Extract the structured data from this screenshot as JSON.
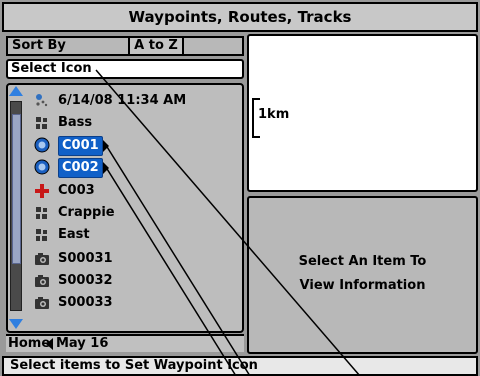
{
  "window": {
    "title": "Waypoints, Routes, Tracks"
  },
  "sort": {
    "label": "Sort By",
    "value": "A to Z"
  },
  "select_icon": {
    "label": "Select Icon"
  },
  "list": {
    "items": [
      {
        "label": "6/14/08 11:34 AM",
        "icon": "track-icon",
        "selected": false
      },
      {
        "label": "Bass",
        "icon": "fish-icon",
        "selected": false
      },
      {
        "label": "C001",
        "icon": "blue-circle-icon",
        "selected": true
      },
      {
        "label": "C002",
        "icon": "blue-circle-icon",
        "selected": true
      },
      {
        "label": "C003",
        "icon": "red-cross-icon",
        "selected": false
      },
      {
        "label": "Crappie",
        "icon": "fish-icon",
        "selected": false
      },
      {
        "label": "East",
        "icon": "fish-icon",
        "selected": false
      },
      {
        "label": "S00031",
        "icon": "camera-icon",
        "selected": false
      },
      {
        "label": "S00032",
        "icon": "camera-icon",
        "selected": false
      },
      {
        "label": "S00033",
        "icon": "camera-icon",
        "selected": false
      }
    ]
  },
  "home_bar": {
    "left": "Home",
    "right": "May 16"
  },
  "map": {
    "scale_label": "1km"
  },
  "info": {
    "line1": "Select An Item To",
    "line2": "View Information"
  },
  "status": {
    "text": "Select items to Set Waypoint Icon"
  },
  "colors": {
    "selection": "#1060c8",
    "scroll_arrow": "#2f7fe0",
    "panel_gray": "#b8b8b8"
  }
}
